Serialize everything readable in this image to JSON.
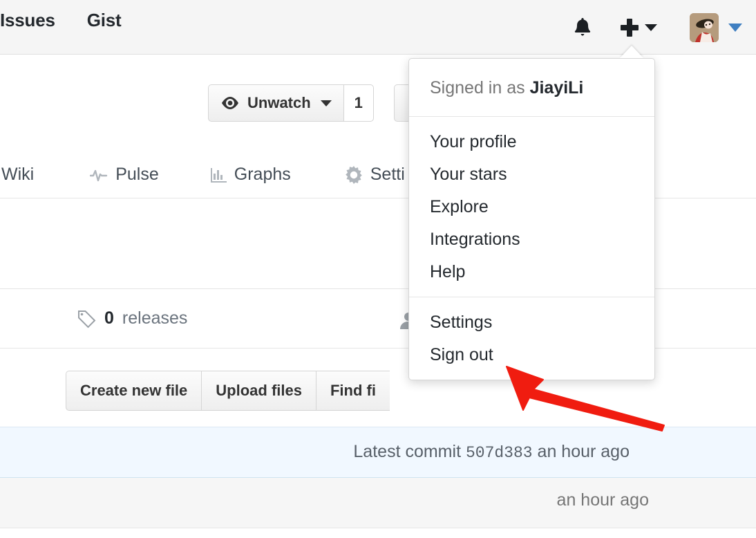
{
  "header": {
    "nav_items": [
      {
        "label": "Issues",
        "name": "nav-issues"
      },
      {
        "label": "Gist",
        "name": "nav-gist"
      }
    ],
    "icons": {
      "notifications": "bell-icon",
      "create_new": "plus-icon",
      "create_new_caret": "chevron-down-icon",
      "avatar": "user-avatar",
      "profile_caret": "chevron-down-icon"
    },
    "accent_caret_color": "#3f7fc1"
  },
  "subheader": {
    "watch_button": {
      "label": "Unwatch",
      "icon": "eye-icon",
      "count": "1"
    }
  },
  "repo_nav": {
    "tabs": [
      {
        "label": "Wiki",
        "icon": "book-icon",
        "name": "tab-wiki"
      },
      {
        "label": "Pulse",
        "icon": "pulse-icon",
        "name": "tab-pulse"
      },
      {
        "label": "Graphs",
        "icon": "graph-icon",
        "name": "tab-graphs"
      },
      {
        "label": "Setti",
        "icon": "gear-icon",
        "name": "tab-settings"
      }
    ]
  },
  "releases": {
    "count": "0",
    "label": "releases",
    "icon": "tag-icon"
  },
  "file_actions": {
    "buttons": [
      {
        "label": "Create new file",
        "name": "create-new-file-button"
      },
      {
        "label": "Upload files",
        "name": "upload-files-button"
      },
      {
        "label": "Find fi",
        "name": "find-file-button"
      }
    ]
  },
  "commit_bar": {
    "prefix": "Latest commit",
    "sha": "507d383",
    "time": "an hour ago"
  },
  "file_list": {
    "time": "an hour ago"
  },
  "dropdown": {
    "signed_in_prefix": "Signed in as",
    "username": "JiayiLi",
    "sections": [
      {
        "items": [
          {
            "label": "Your profile",
            "name": "menu-your-profile"
          },
          {
            "label": "Your stars",
            "name": "menu-your-stars"
          },
          {
            "label": "Explore",
            "name": "menu-explore"
          },
          {
            "label": "Integrations",
            "name": "menu-integrations"
          },
          {
            "label": "Help",
            "name": "menu-help"
          }
        ]
      },
      {
        "items": [
          {
            "label": "Settings",
            "name": "menu-settings"
          },
          {
            "label": "Sign out",
            "name": "menu-sign-out"
          }
        ]
      }
    ]
  },
  "annotation": {
    "arrow_color": "#f01c10",
    "points_to": "Settings"
  }
}
